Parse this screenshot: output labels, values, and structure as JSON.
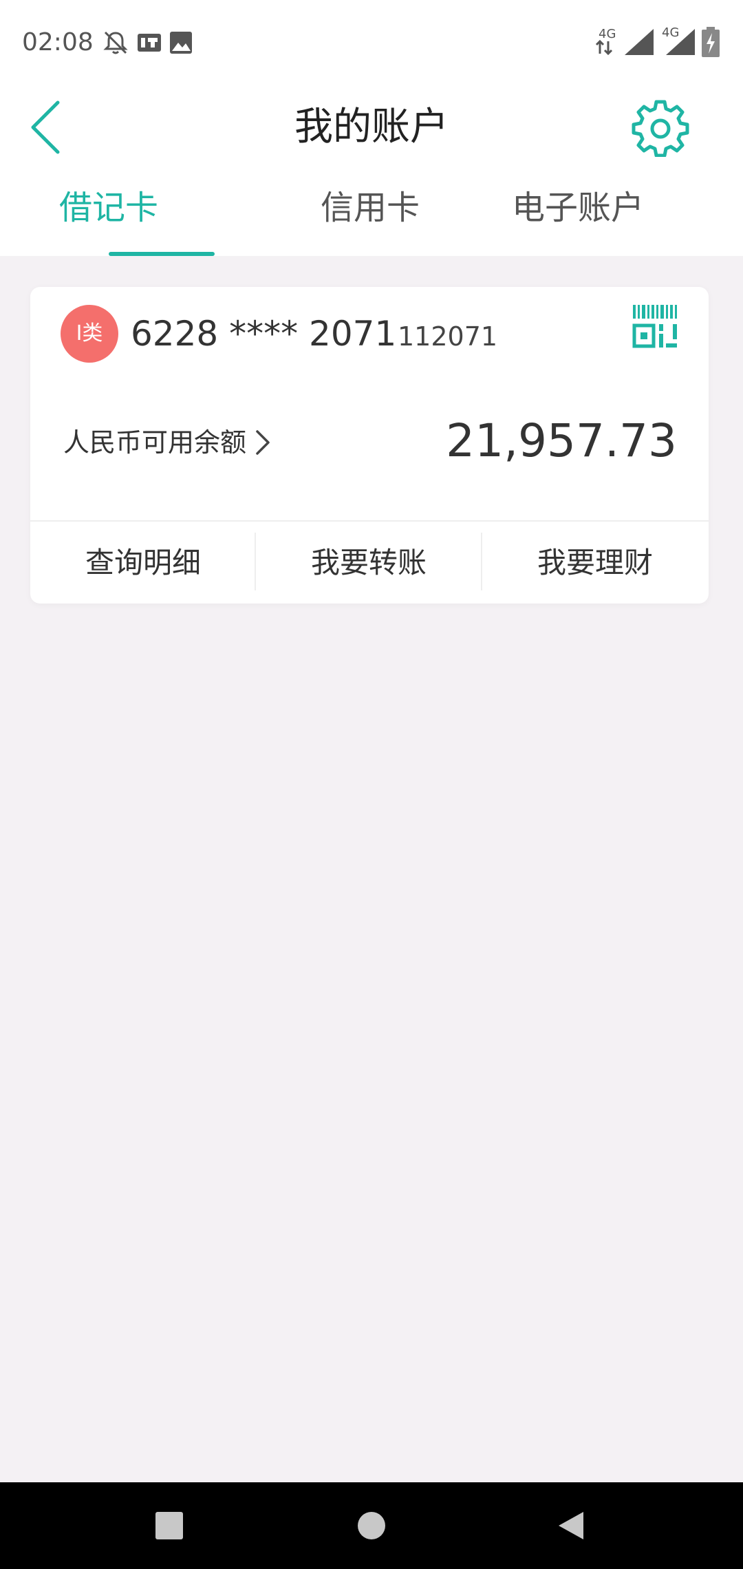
{
  "status_bar": {
    "time": "02:08",
    "net1": "4G",
    "net2": "4G",
    "icons": [
      "bell-off-icon",
      "notification-icon",
      "image-icon",
      "data-arrows-icon",
      "signal-icon",
      "signal-icon",
      "battery-charging-icon"
    ]
  },
  "header": {
    "title": "我的账户",
    "back_icon": "chevron-left-icon",
    "settings_icon": "gear-icon"
  },
  "tabs": [
    {
      "label": "借记卡",
      "active": true
    },
    {
      "label": "信用卡",
      "active": false
    },
    {
      "label": "电子账户",
      "active": false
    }
  ],
  "card": {
    "badge": "I类",
    "number": "6228 **** 2071",
    "suffix": "112071",
    "qr_icon": "barcode-qr-icon",
    "balance_label": "人民币可用余额",
    "balance": "21,957.73",
    "actions": [
      {
        "label": "查询明细"
      },
      {
        "label": "我要转账"
      },
      {
        "label": "我要理财"
      }
    ]
  },
  "nav": {
    "icons": [
      "recent-apps-icon",
      "home-icon",
      "back-icon"
    ]
  },
  "colors": {
    "accent": "#1fb5a4",
    "badge": "#f46f6c",
    "background": "#f4f1f4"
  }
}
